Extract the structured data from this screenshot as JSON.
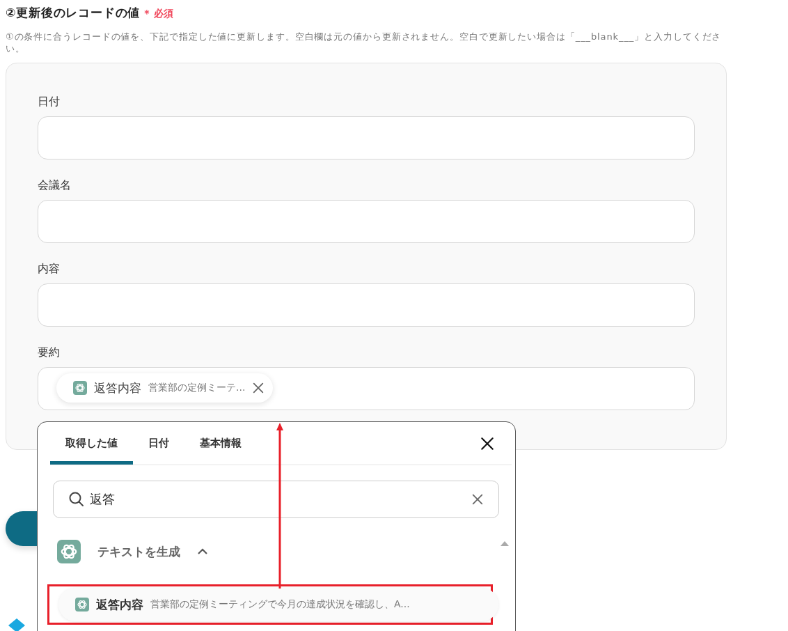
{
  "section": {
    "title": "②更新後のレコードの値",
    "required_mark": "*",
    "required_label": "必須",
    "description": "①の条件に合うレコードの値を、下記で指定した値に更新します。空白欄は元の値から更新されません。空白で更新したい場合は「___blank___」と入力してください。"
  },
  "fields": [
    {
      "label": "日付"
    },
    {
      "label": "会議名"
    },
    {
      "label": "内容"
    },
    {
      "label": "要約",
      "chip": {
        "name": "返答内容",
        "preview": "営業部の定例ミーテ..."
      }
    }
  ],
  "picker": {
    "tabs": [
      {
        "label": "取得した値",
        "selected": true
      },
      {
        "label": "日付",
        "selected": false
      },
      {
        "label": "基本情報",
        "selected": false
      }
    ],
    "search": {
      "value": "返答"
    },
    "groups": [
      {
        "title": "テキストを生成",
        "expanded": true,
        "items": [
          {
            "name": "返答内容",
            "preview": "営業部の定例ミーティングで今月の達成状況を確認し、A...",
            "highlighted": true
          }
        ]
      }
    ]
  }
}
